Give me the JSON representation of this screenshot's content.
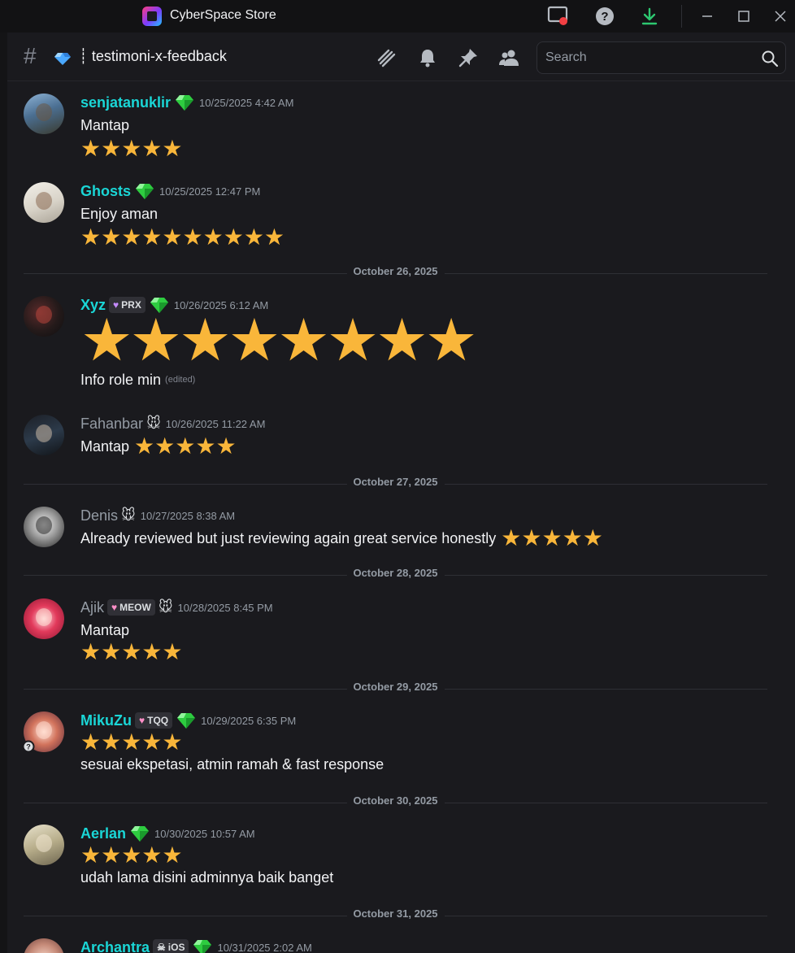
{
  "titlebar": {
    "title": "CyberSpace Store"
  },
  "channel": {
    "name": "┊ testimoni-x-feedback"
  },
  "search": {
    "placeholder": "Search"
  },
  "colors": {
    "accent_cyan": "#1ad6d6",
    "star": "#f9b63a",
    "gem": "#2ecc40"
  },
  "messages": [
    {
      "username": "senjatanuklir",
      "role_icon": "gem",
      "timestamp": "10/25/2025 4:42 AM",
      "text": "Mantap",
      "stars": "★★★★★"
    },
    {
      "username": "Ghosts",
      "role_icon": "gem",
      "timestamp": "10/25/2025 12:47 PM",
      "text": "Enjoy aman",
      "stars": "★★★★★★★★★★"
    },
    {
      "username": "Xyz",
      "tag": "PRX",
      "role_icon": "gem",
      "timestamp": "10/26/2025 6:12 AM",
      "stars": "★★★★★★★★",
      "text": "Info role min",
      "edited": "(edited)"
    },
    {
      "username": "Fahanbar",
      "role_icon": "mouse",
      "timestamp": "10/26/2025 11:22 AM",
      "text": "Mantap",
      "stars": "★★★★★"
    },
    {
      "username": "Denis",
      "role_icon": "mouse",
      "timestamp": "10/27/2025 8:38 AM",
      "text": "Already reviewed but just reviewing again great service honestly",
      "stars": "★★★★★"
    },
    {
      "username": "Ajik",
      "tag": "MEOW",
      "role_icon": "mouse",
      "timestamp": "10/28/2025 8:45 PM",
      "text": "Mantap",
      "stars": "★★★★★"
    },
    {
      "username": "MikuZu",
      "tag": "TQQ",
      "role_icon": "gem",
      "timestamp": "10/29/2025 6:35 PM",
      "stars": "★★★★★",
      "text": "sesuai ekspetasi, atmin ramah & fast response"
    },
    {
      "username": "Aerlan",
      "role_icon": "gem",
      "timestamp": "10/30/2025 10:57 AM",
      "stars": "★★★★★",
      "text": "udah lama disini adminnya baik banget"
    },
    {
      "username": "Archantra",
      "tag": "iOS",
      "role_icon": "gem",
      "timestamp": "10/31/2025 2:02 AM"
    }
  ],
  "dividers": [
    "October 26, 2025",
    "October 27, 2025",
    "October 28, 2025",
    "October 29, 2025",
    "October 30, 2025",
    "October 31, 2025"
  ]
}
